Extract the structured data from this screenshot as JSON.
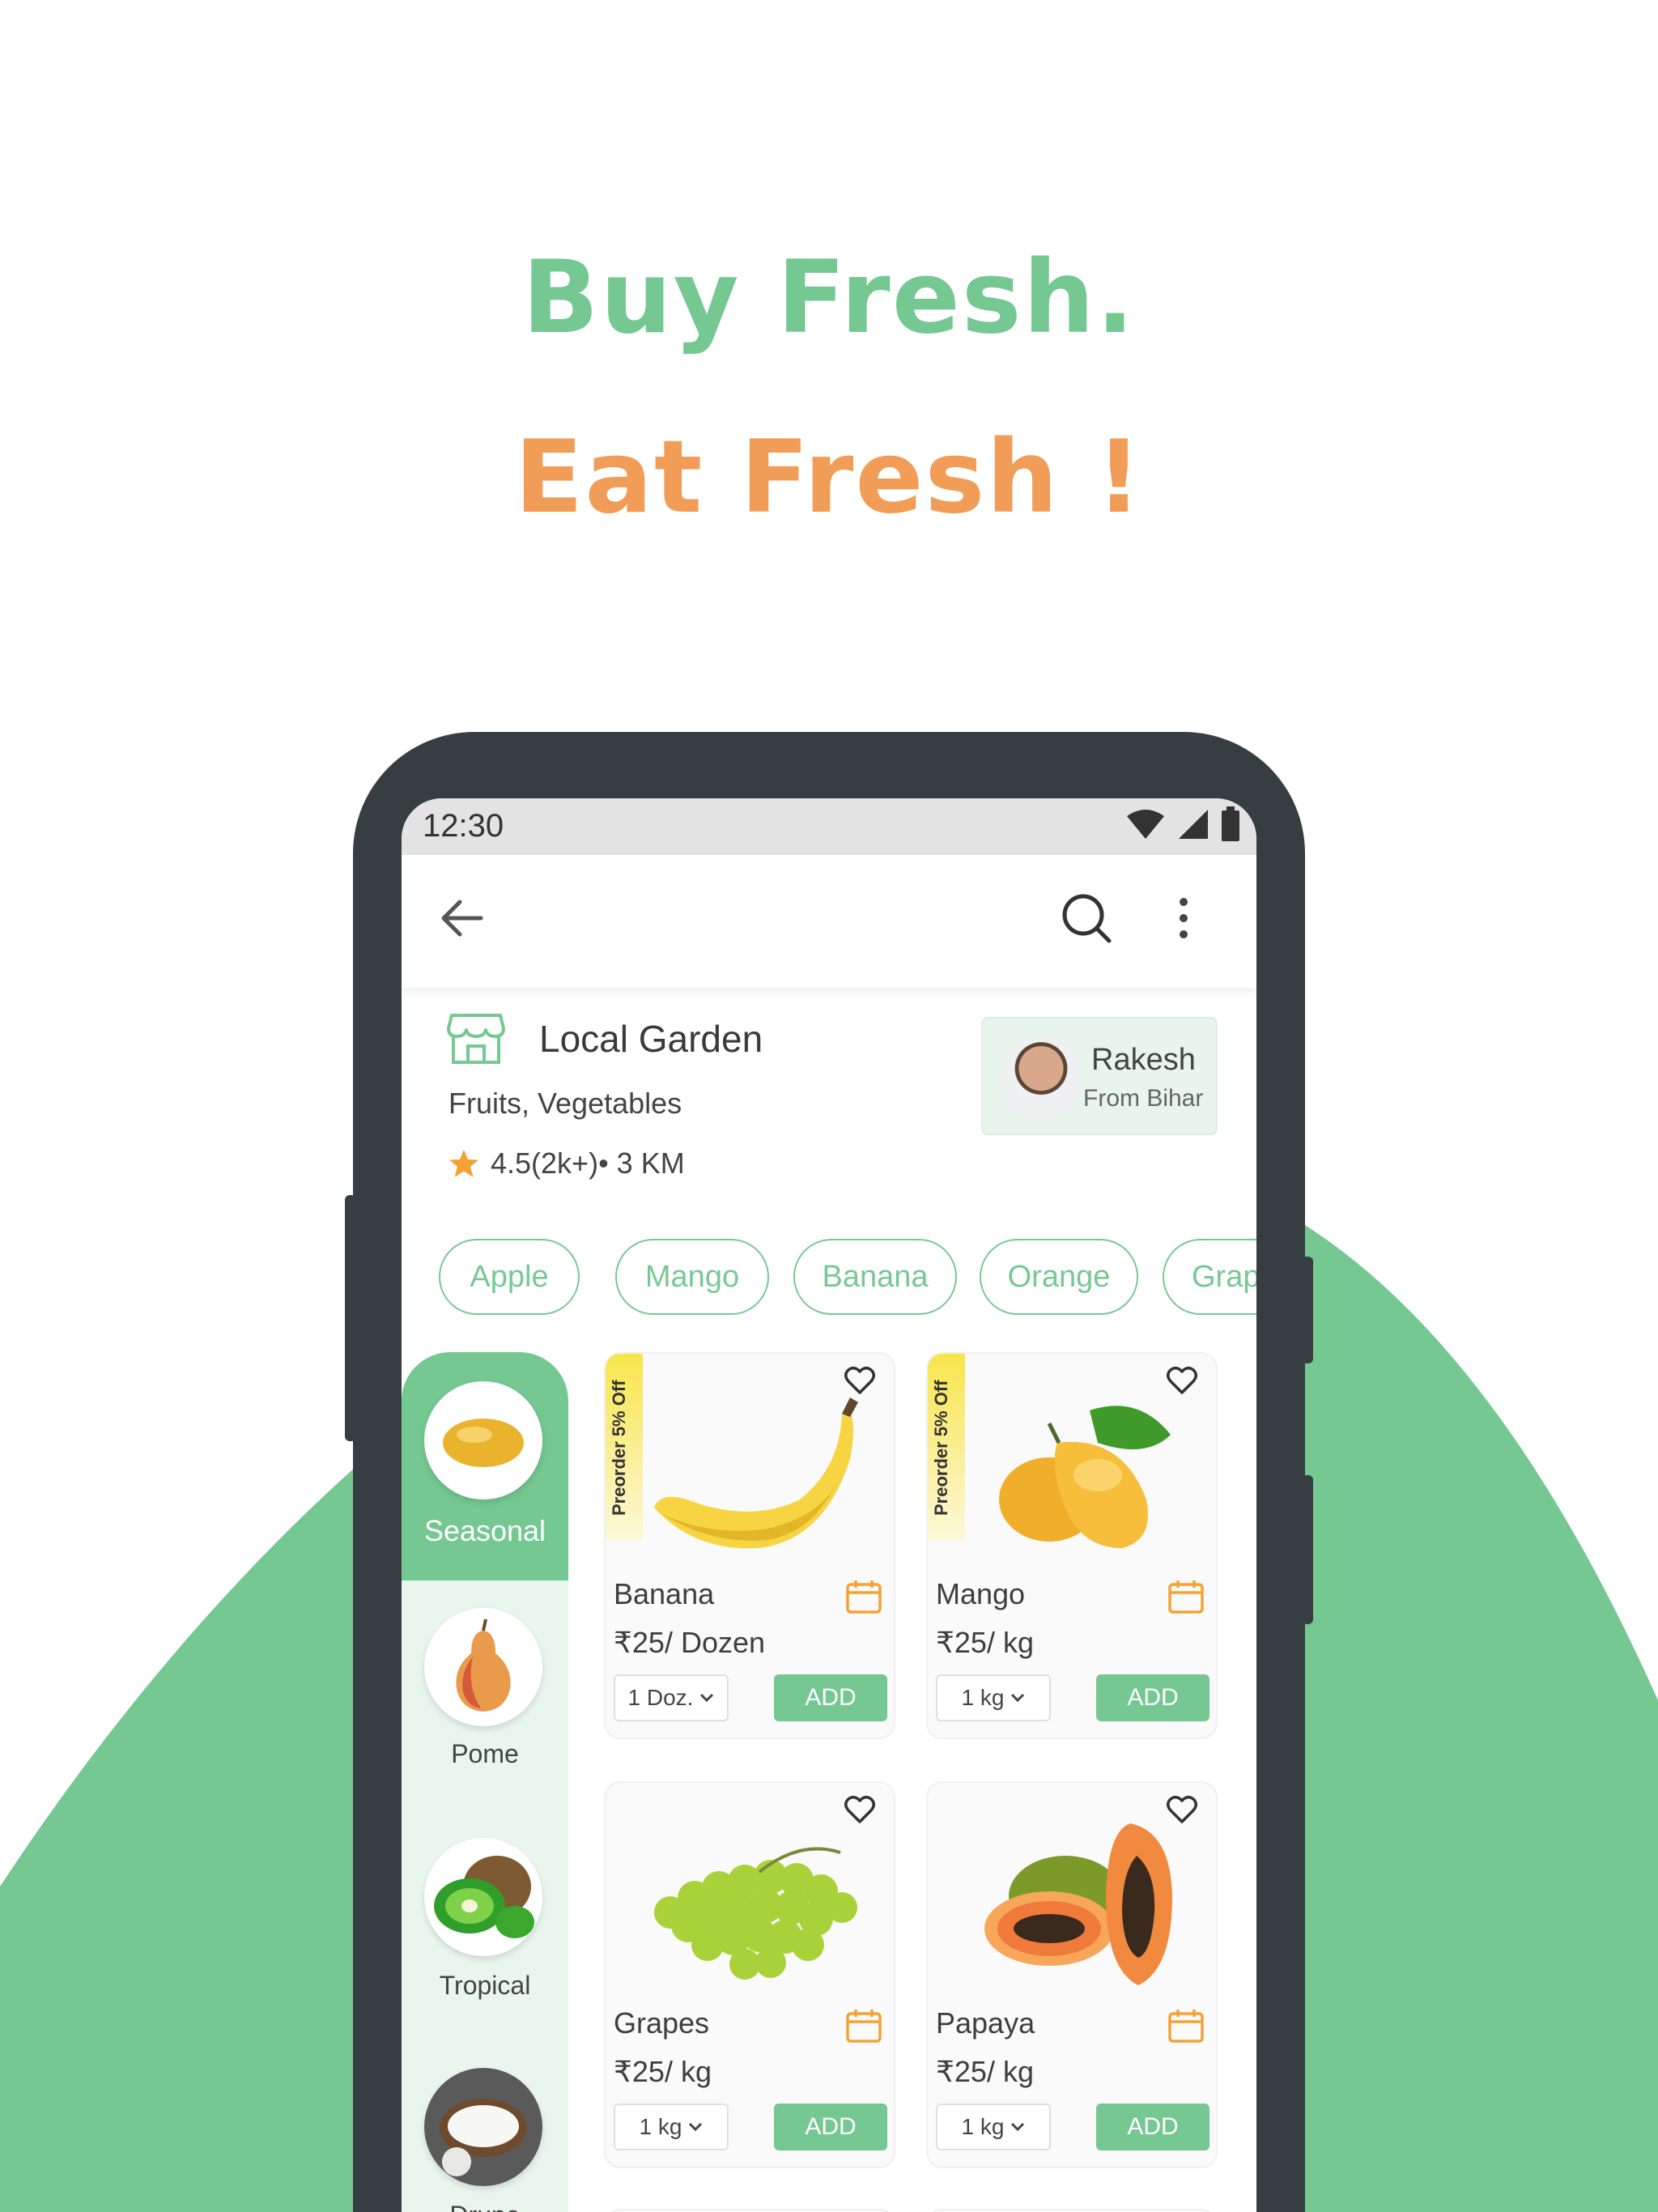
{
  "headline": {
    "line1": "Buy Fresh.",
    "line2": "Eat Fresh !"
  },
  "status_bar": {
    "time": "12:30"
  },
  "store": {
    "name": "Local Garden",
    "categories": "Fruits, Vegetables",
    "rating": "4.5(2k+)• 3 KM"
  },
  "seller": {
    "name": "Rakesh",
    "location": "From Bihar"
  },
  "chips": [
    "Apple",
    "Mango",
    "Banana",
    "Orange",
    "Grap"
  ],
  "sidebar": {
    "items": [
      {
        "label": "Seasonal",
        "active": true
      },
      {
        "label": "Pome",
        "active": false
      },
      {
        "label": "Tropical",
        "active": false
      },
      {
        "label": "Drupe",
        "active": false
      }
    ]
  },
  "products": [
    {
      "name": "Banana",
      "price": "₹25/ Dozen",
      "qty": "1 Doz.",
      "add_label": "ADD",
      "ribbon": "Preorder 5% Off"
    },
    {
      "name": "Mango",
      "price": "₹25/ kg",
      "qty": "1 kg",
      "add_label": "ADD",
      "ribbon": "Preorder 5% Off"
    },
    {
      "name": "Grapes",
      "price": "₹25/ kg",
      "qty": "1 kg",
      "add_label": "ADD",
      "ribbon": ""
    },
    {
      "name": "Papaya",
      "price": "₹25/ kg",
      "qty": "1 kg",
      "add_label": "ADD",
      "ribbon": ""
    }
  ],
  "colors": {
    "green": "#75c892",
    "orange": "#f19c57",
    "frame": "#373e42"
  },
  "icons": [
    "back-arrow-icon",
    "search-icon",
    "more-vert-icon",
    "store-icon",
    "star-icon",
    "heart-icon",
    "calendar-icon",
    "chevron-down-icon",
    "wifi-icon",
    "signal-icon",
    "battery-icon"
  ]
}
